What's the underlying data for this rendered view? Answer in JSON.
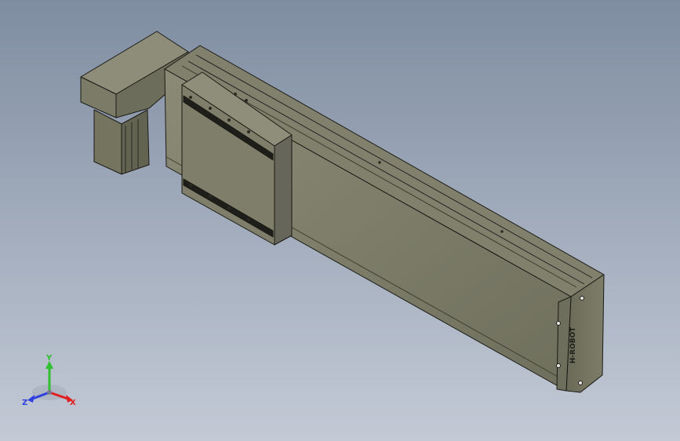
{
  "viewport": {
    "background": {
      "top": "#7f8da1",
      "bottom": "#c3cad6"
    },
    "model_color": "#7a7a66",
    "model_color_light": "#8a8a75",
    "model_color_dark": "#5c5c4c"
  },
  "end_cap": {
    "brand_text": "H-ROBOT"
  },
  "triad": {
    "x_label": "X",
    "y_label": "Y",
    "z_label": "Z",
    "x_color": "#e02020",
    "y_color": "#2fbf2f",
    "z_color": "#2f3fdf"
  }
}
